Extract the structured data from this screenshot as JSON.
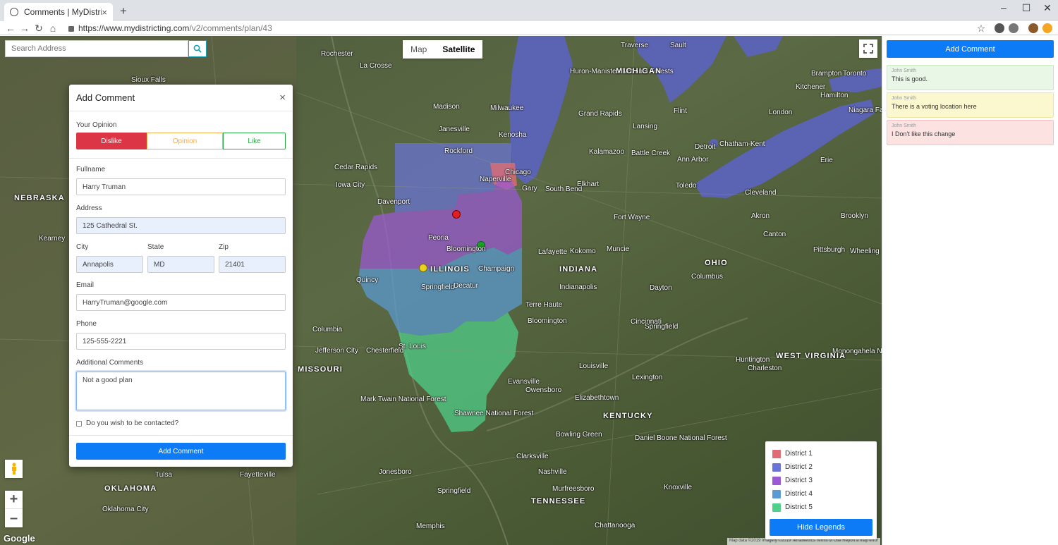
{
  "browser": {
    "tab_title": "Comments | MyDistricting",
    "tab_close": "×",
    "new_tab": "+",
    "url_host": "https://www.mydistricting.com",
    "url_path": "/v2/comments/plan/43",
    "win_min": "–",
    "win_max": "☐",
    "win_close": "✕"
  },
  "map": {
    "search_placeholder": "Search Address",
    "type_map": "Map",
    "type_satellite": "Satellite",
    "google_logo": "Google",
    "attribution": "Map data ©2019 Imagery ©2019 TerraMetrics   Terms of Use   Report a map error",
    "labels": [
      {
        "text": "Rochester"
      },
      {
        "text": "La Crosse"
      },
      {
        "text": "Madison"
      },
      {
        "text": "Milwaukee"
      },
      {
        "text": "Janesville"
      },
      {
        "text": "Kenosha"
      },
      {
        "text": "Rockford"
      },
      {
        "text": "Chicago"
      },
      {
        "text": "Naperville"
      },
      {
        "text": "Gary"
      },
      {
        "text": "South Bend"
      },
      {
        "text": "Elkhart"
      },
      {
        "text": "Cedar Rapids"
      },
      {
        "text": "Iowa City"
      },
      {
        "text": "Davenport"
      },
      {
        "text": "Peoria"
      },
      {
        "text": "Bloomington"
      },
      {
        "text": "Champaign"
      },
      {
        "text": "Springfield"
      },
      {
        "text": "Decatur"
      },
      {
        "text": "Quincy"
      },
      {
        "text": "Fort Wayne"
      },
      {
        "text": "Lafayette"
      },
      {
        "text": "Kokomo"
      },
      {
        "text": "Indianapolis"
      },
      {
        "text": "Terre Haute"
      },
      {
        "text": "Columbia"
      },
      {
        "text": "Jefferson City"
      },
      {
        "text": "St. Louis"
      },
      {
        "text": "Chesterfield"
      },
      {
        "text": "Evansville"
      },
      {
        "text": "Owensboro"
      },
      {
        "text": "Louisville"
      },
      {
        "text": "Lexington"
      },
      {
        "text": "Cincinnati"
      },
      {
        "text": "Dayton"
      },
      {
        "text": "Columbus"
      },
      {
        "text": "Toledo"
      },
      {
        "text": "Detroit"
      },
      {
        "text": "Ann Arbor"
      },
      {
        "text": "Cleveland"
      },
      {
        "text": "Pittsburgh"
      },
      {
        "text": "Grand Rapids"
      },
      {
        "text": "Lansing"
      },
      {
        "text": "Kalamazoo"
      },
      {
        "text": "Flint"
      },
      {
        "text": "London"
      },
      {
        "text": "Toronto"
      },
      {
        "text": "Hamilton"
      },
      {
        "text": "Niagara Falls"
      },
      {
        "text": "Erie"
      },
      {
        "text": "Kitchener"
      },
      {
        "text": "Brampton"
      },
      {
        "text": "Chatham-Kent"
      },
      {
        "text": "Sioux Falls"
      },
      {
        "text": "Kearney"
      },
      {
        "text": "Nashville"
      },
      {
        "text": "Clarksville"
      },
      {
        "text": "Bowling Green"
      },
      {
        "text": "Memphis"
      },
      {
        "text": "Murfreesboro"
      },
      {
        "text": "Knoxville"
      },
      {
        "text": "Chattanooga"
      },
      {
        "text": "Jonesboro"
      },
      {
        "text": "Fayetteville"
      },
      {
        "text": "Oklahoma City"
      },
      {
        "text": "Tulsa"
      },
      {
        "text": "Springfield"
      },
      {
        "text": "Huntington"
      },
      {
        "text": "Charleston"
      },
      {
        "text": "Bloomington"
      },
      {
        "text": "Muncie"
      },
      {
        "text": "Springfield"
      },
      {
        "text": "Elizabethtown"
      },
      {
        "text": "Huron-Manistee National Forests"
      },
      {
        "text": "Mark Twain National Forest"
      },
      {
        "text": "Shawnee National Forest"
      },
      {
        "text": "Daniel Boone National Forest"
      },
      {
        "text": "Monongahela National Forest"
      },
      {
        "text": "Wheeling"
      },
      {
        "text": "Brooklyn"
      },
      {
        "text": "Canton"
      },
      {
        "text": "Akron"
      },
      {
        "text": "Battle Creek"
      },
      {
        "text": "Traverse"
      },
      {
        "text": "Sault"
      }
    ],
    "state_labels": [
      {
        "text": "NEBRASKA"
      },
      {
        "text": "MISSOURI"
      },
      {
        "text": "ILLINOIS"
      },
      {
        "text": "INDIANA"
      },
      {
        "text": "OHIO"
      },
      {
        "text": "MICHIGAN"
      },
      {
        "text": "KENTUCKY"
      },
      {
        "text": "TENNESSEE"
      },
      {
        "text": "OKLAHOMA"
      },
      {
        "text": "WEST VIRGINIA"
      }
    ],
    "district_colors": [
      "#e06c75",
      "#6a74d8",
      "#9b59d6",
      "#5a9bd4",
      "#4fd18b"
    ]
  },
  "legend": {
    "items": [
      {
        "label": "District 1",
        "color": "#e06c75"
      },
      {
        "label": "District 2",
        "color": "#6a74d8"
      },
      {
        "label": "District 3",
        "color": "#9b59d6"
      },
      {
        "label": "District 4",
        "color": "#5a9bd4"
      },
      {
        "label": "District 5",
        "color": "#4fd18b"
      }
    ],
    "hide_button": "Hide Legends"
  },
  "modal": {
    "title": "Add Comment",
    "close": "×",
    "opinion_label": "Your Opinion",
    "opinion_dislike": "Dislike",
    "opinion_neutral": "Opinion",
    "opinion_like": "Like",
    "fullname_label": "Fullname",
    "fullname_value": "Harry Truman",
    "address_label": "Address",
    "address_value": "125 Cathedral St.",
    "city_label": "City",
    "city_value": "Annapolis",
    "state_label": "State",
    "state_value": "MD",
    "zip_label": "Zip",
    "zip_value": "21401",
    "email_label": "Email",
    "email_value": "HarryTruman@google.com",
    "phone_label": "Phone",
    "phone_value": "125-555-2221",
    "comments_label": "Additional Comments",
    "comments_value": "Not a good plan",
    "contact_label": "Do you wish to be contacted?",
    "submit": "Add Comment"
  },
  "panel": {
    "add_button": "Add Comment",
    "comments": [
      {
        "author": "John Smith",
        "text": "This is good.",
        "bg": "#e8f7e6",
        "border": "#c6e9c0"
      },
      {
        "author": "John Smith",
        "text": "There is a voting location here",
        "bg": "#fbf7cf",
        "border": "#efe6a2"
      },
      {
        "author": "John Smith",
        "text": "I Don't like this change",
        "bg": "#fde2e2",
        "border": "#f4c2c2"
      }
    ]
  },
  "colors": {
    "primary": "#0d7bf5",
    "danger": "#dc3545",
    "warning": "#f0ad4e",
    "success": "#28a745",
    "lake": "#5b63b3"
  }
}
